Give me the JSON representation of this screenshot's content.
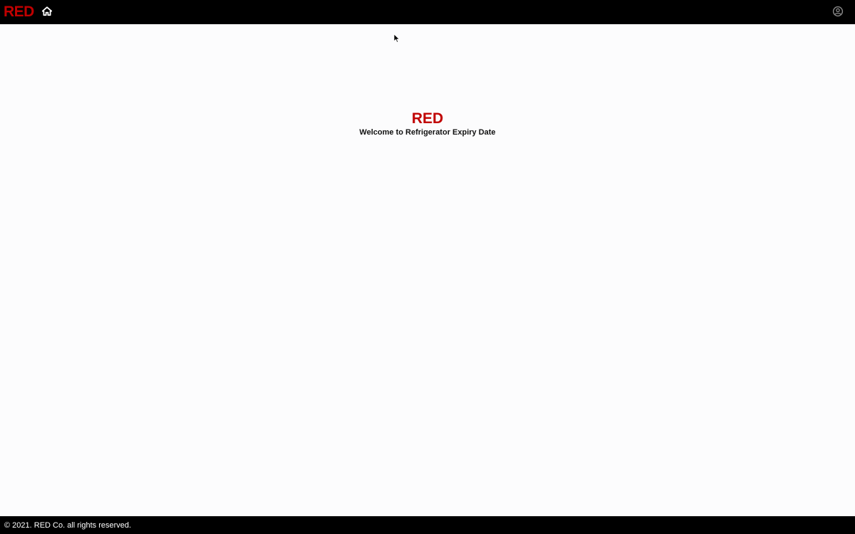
{
  "header": {
    "brand": "RED",
    "home_icon": "home-icon",
    "account_icon": "account-circle-icon"
  },
  "main": {
    "title": "RED",
    "subtitle": "Welcome to Refrigerator Expiry Date"
  },
  "footer": {
    "text": "© 2021. RED Co. all rights reserved."
  },
  "colors": {
    "brand_red": "#c00000",
    "topbar_bg": "#000000",
    "page_bg": "#fcfcfd",
    "footer_bg": "#000000",
    "icon_white": "#ffffff",
    "icon_gray": "#8a8a8a"
  }
}
